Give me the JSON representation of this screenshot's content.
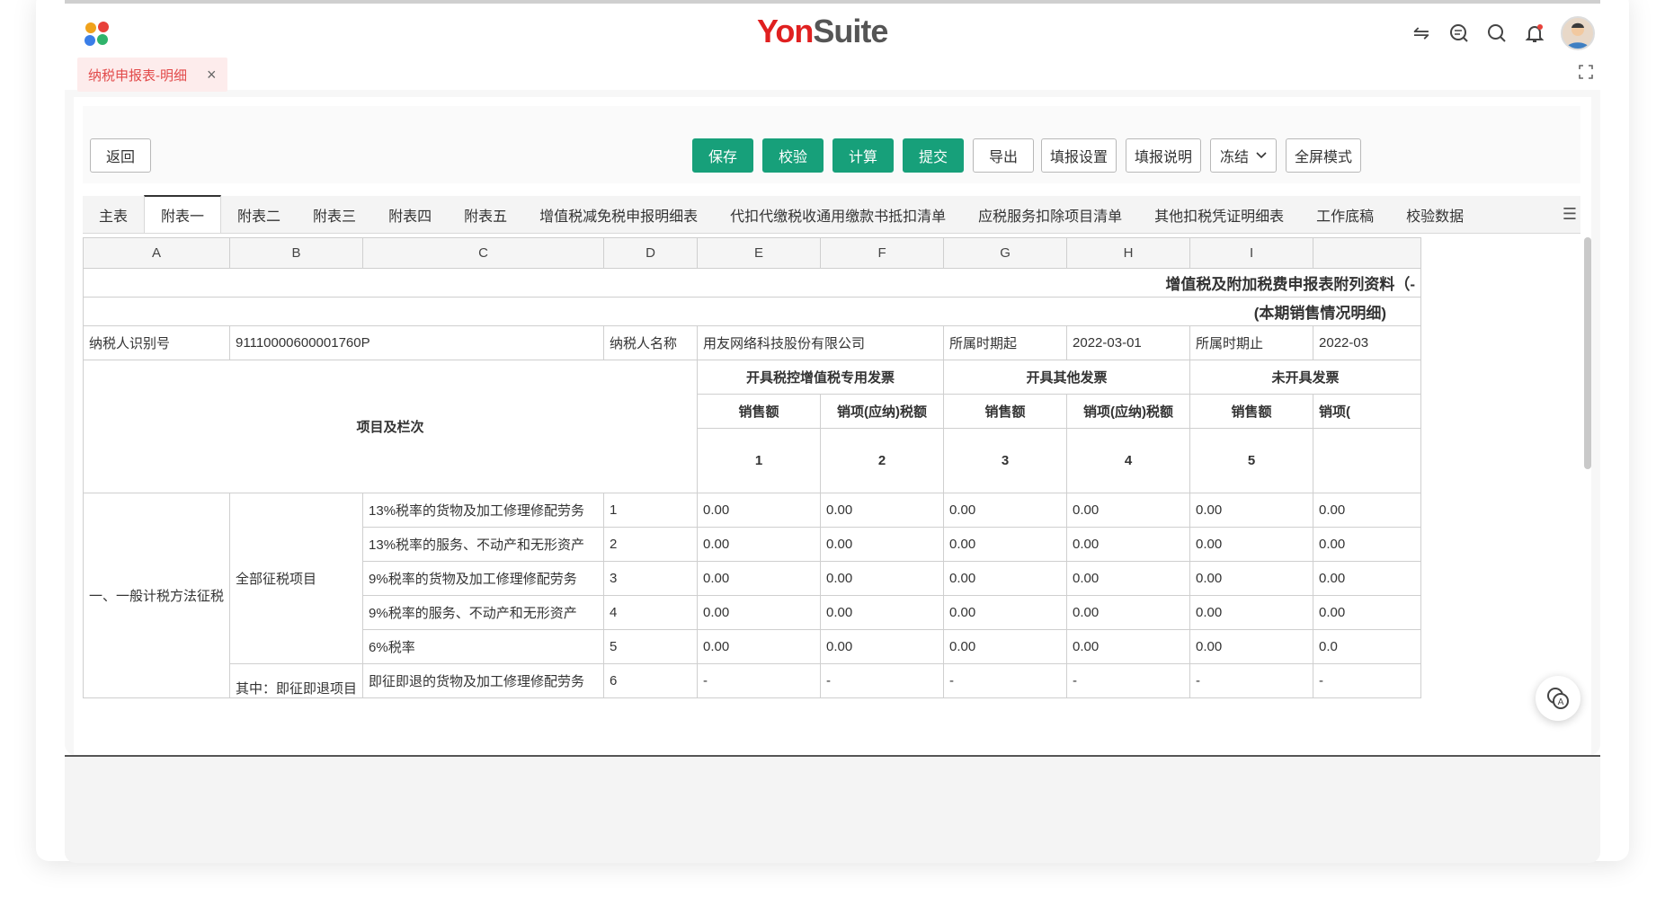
{
  "app": {
    "brand_prefix": "Yon",
    "brand_suffix": "Suite",
    "open_tab": "纳税申报表-明细",
    "close_glyph": "×"
  },
  "toolbar": {
    "back": "返回",
    "save": "保存",
    "verify": "校验",
    "calculate": "计算",
    "submit": "提交",
    "export": "导出",
    "fill_settings": "填报设置",
    "fill_instructions": "填报说明",
    "freeze": "冻结",
    "fullscreen": "全屏模式"
  },
  "sheet_tabs": [
    "主表",
    "附表一",
    "附表二",
    "附表三",
    "附表四",
    "附表五",
    "增值税减免税申报明细表",
    "代扣代缴税收通用缴款书抵扣清单",
    "应税服务扣除项目清单",
    "其他扣税凭证明细表",
    "工作底稿",
    "校验数据"
  ],
  "active_sheet_tab_index": 1,
  "columns": [
    "A",
    "B",
    "C",
    "D",
    "E",
    "F",
    "G",
    "H",
    "I"
  ],
  "sheet": {
    "title": "增值税及附加税费申报表附列资料（-",
    "subtitle": "(本期销售情况明细)",
    "taxpayer_id_label": "纳税人识别号",
    "taxpayer_id": "91110000600001760P",
    "taxpayer_name_label": "纳税人名称",
    "taxpayer_name": "用友网络科技股份有限公司",
    "period_start_label": "所属时期起",
    "period_start": "2022-03-01",
    "period_end_label": "所属时期止",
    "period_end": "2022-03",
    "item_col_header": "项目及栏次",
    "group1": "开具税控增值税专用发票",
    "group2": "开具其他发票",
    "group3": "未开具发票",
    "sales_amount": "销售额",
    "output_tax": "销项(应纳)税额",
    "output_tax_cut": "销项(",
    "col_nums": [
      "1",
      "2",
      "3",
      "4",
      "5"
    ],
    "section1": "一、一般计税方法征税",
    "subsection1": "全部征税项目",
    "subsection2": "其中：即征即退项目",
    "rows": [
      {
        "name": "13%税率的货物及加工修理修配劳务",
        "no": "1",
        "vals": [
          "0.00",
          "0.00",
          "0.00",
          "0.00",
          "0.00",
          "0.00"
        ]
      },
      {
        "name": "13%税率的服务、不动产和无形资产",
        "no": "2",
        "vals": [
          "0.00",
          "0.00",
          "0.00",
          "0.00",
          "0.00",
          "0.00"
        ]
      },
      {
        "name": "9%税率的货物及加工修理修配劳务",
        "no": "3",
        "vals": [
          "0.00",
          "0.00",
          "0.00",
          "0.00",
          "0.00",
          "0.00"
        ]
      },
      {
        "name": "9%税率的服务、不动产和无形资产",
        "no": "4",
        "vals": [
          "0.00",
          "0.00",
          "0.00",
          "0.00",
          "0.00",
          "0.00"
        ]
      },
      {
        "name": "6%税率",
        "no": "5",
        "vals": [
          "0.00",
          "0.00",
          "0.00",
          "0.00",
          "0.00",
          "0.0"
        ]
      },
      {
        "name": "即征即退的货物及加工修理修配劳务",
        "no": "6",
        "vals": [
          "-",
          "-",
          "-",
          "-",
          "-",
          "-"
        ]
      }
    ]
  }
}
